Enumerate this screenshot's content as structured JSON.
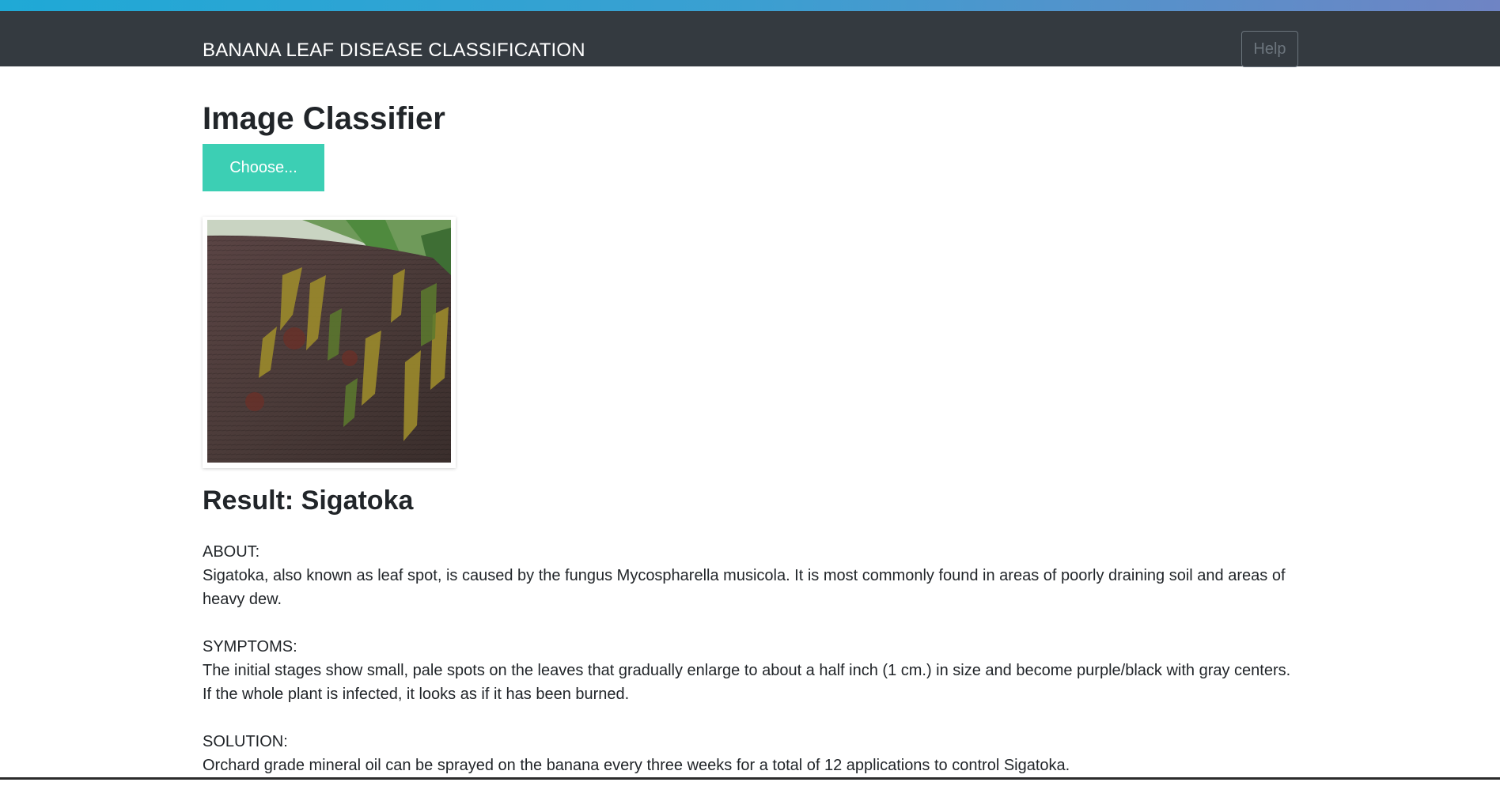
{
  "navbar": {
    "brand": "BANANA LEAF DISEASE CLASSIFICATION",
    "help_label": "Help"
  },
  "main": {
    "title": "Image Classifier",
    "choose_label": "Choose...",
    "result_heading": "Result: Sigatoka",
    "sections": [
      {
        "label": "ABOUT:",
        "text": "Sigatoka, also known as leaf spot, is caused by the fungus Mycospharella musicola. It is most commonly found in areas of poorly draining soil and areas of heavy dew."
      },
      {
        "label": "SYMPTOMS:",
        "text": "The initial stages show small, pale spots on the leaves that gradually enlarge to about a half inch (1 cm.) in size and become purple/black with gray centers. If the whole plant is infected, it looks as if it has been burned."
      },
      {
        "label": "SOLUTION:",
        "text": "Orchard grade mineral oil can be sprayed on the banana every three weeks for a total of 12 applications to control Sigatoka."
      }
    ]
  },
  "colors": {
    "navbar_bg": "#343a40",
    "accent_button": "#3ccfb4",
    "stripe_start": "#1fa9d6",
    "stripe_end": "#6f84c4"
  }
}
